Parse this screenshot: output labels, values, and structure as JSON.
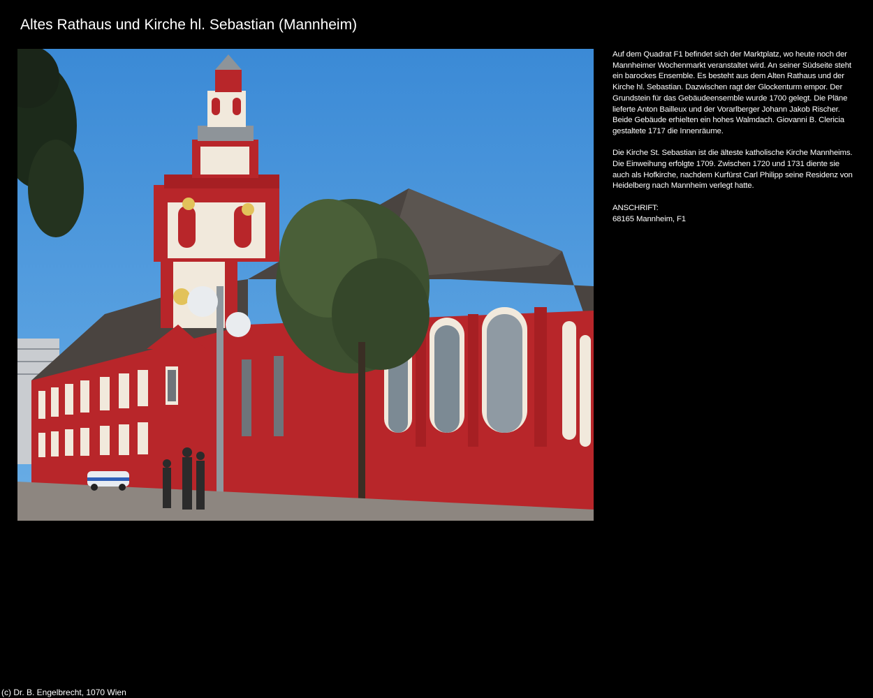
{
  "page": {
    "title": "Altes Rathaus und Kirche hl. Sebastian (Mannheim)",
    "background": "#000000"
  },
  "photo": {
    "alt": "Altes Rathaus und Kirche hl. Sebastian (Mannheim)",
    "sky_color": "#3f8fd8",
    "building_color": "#b8262a"
  },
  "description": {
    "paragraph_1": "Auf dem Quadrat F1 befindet sich der Marktplatz, wo heute noch der Mannheimer Wochenmarkt veranstaltet wird. An seiner Südseite steht ein barockes Ensemble. Es besteht aus dem Alten Rathaus und der Kirche hl. Sebastian. Dazwischen ragt der Glockenturm empor. Der Grundstein für das Gebäudeensemble wurde 1700 gelegt. Die Pläne lieferte Anton Bailleux und der Vorarlberger Johann Jakob Rischer. Beide Gebäude erhielten ein hohes Walmdach. Giovanni B. Clericia gestaltete 1717 die Innenräume.",
    "paragraph_2": "Die Kirche St. Sebastian ist die älteste katholische Kirche Mannheims. Die Einweihung erfolgte 1709. Zwischen 1720 und 1731 diente sie auch als Hofkirche, nachdem Kurfürst Carl Philipp seine Residenz von Heidelberg nach Mannheim verlegt hatte.",
    "address_label": "ANSCHRIFT:",
    "address_value": "68165 Mannheim, F1"
  },
  "footer": {
    "copyright": "(c) Dr. B. Engelbrecht, 1070 Wien"
  }
}
